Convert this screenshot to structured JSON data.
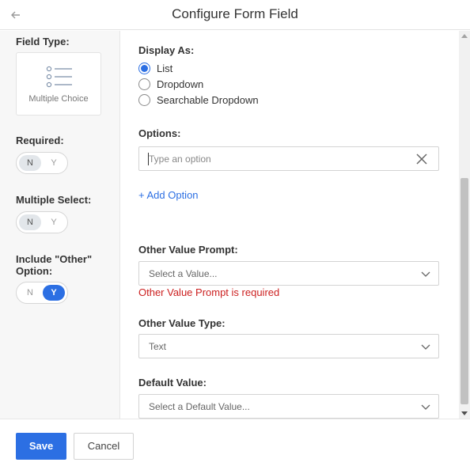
{
  "header": {
    "title": "Configure Form Field",
    "back_icon": "arrow-left-icon"
  },
  "sidebar": {
    "field_type_label": "Field Type:",
    "field_type_value": "Multiple Choice",
    "field_type_icon": "list-icon",
    "required": {
      "label": "Required:",
      "no": "N",
      "yes": "Y",
      "selected": "N"
    },
    "multiple_select": {
      "label": "Multiple Select:",
      "no": "N",
      "yes": "Y",
      "selected": "N"
    },
    "include_other": {
      "label_line1": "Include \"Other\"",
      "label_line2": "Option:",
      "no": "N",
      "yes": "Y",
      "selected": "Y"
    }
  },
  "main": {
    "display_as": {
      "label": "Display As:",
      "options": [
        "List",
        "Dropdown",
        "Searchable Dropdown"
      ],
      "selected": "List"
    },
    "options": {
      "label": "Options:",
      "placeholder": "Type an option",
      "add_label": "+ Add Option"
    },
    "other_value_prompt": {
      "label": "Other Value Prompt:",
      "placeholder": "Select a Value...",
      "error": "Other Value Prompt is required"
    },
    "other_value_type": {
      "label": "Other Value Type:",
      "value": "Text"
    },
    "default_value": {
      "label": "Default Value:",
      "placeholder": "Select a Default Value..."
    }
  },
  "footer": {
    "save_label": "Save",
    "cancel_label": "Cancel"
  },
  "colors": {
    "accent": "#2c6fe3",
    "error": "#cc2020",
    "sidebar_bg": "#f7f7f7"
  }
}
